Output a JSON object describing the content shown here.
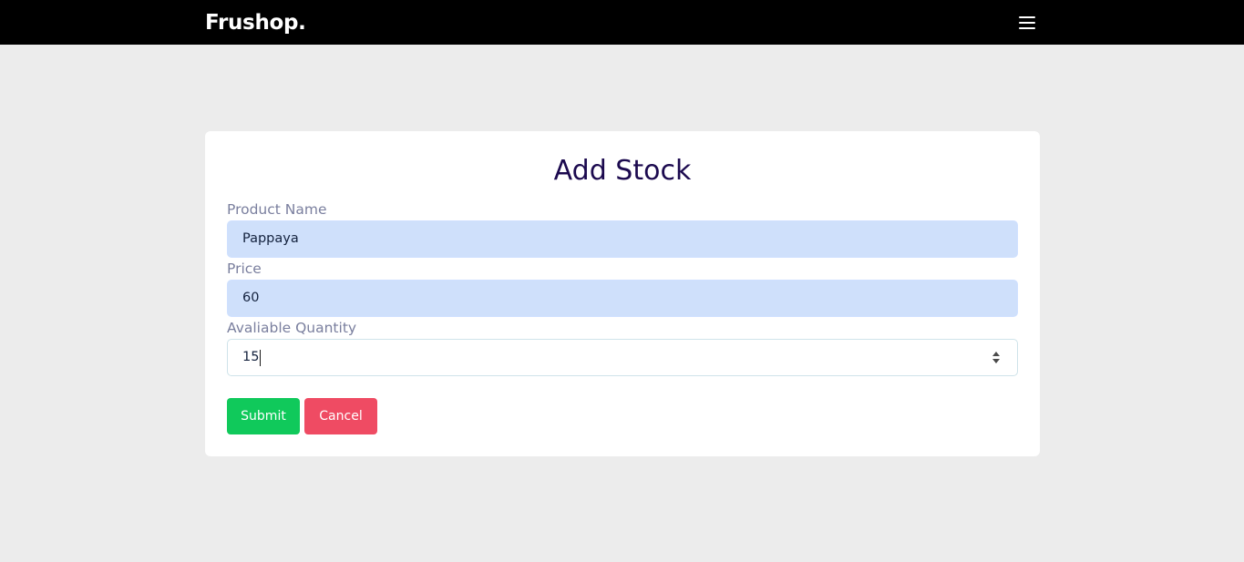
{
  "navbar": {
    "brand": "Frushop.",
    "menu_icon": "hamburger-menu-icon"
  },
  "form": {
    "title": "Add Stock",
    "fields": [
      {
        "label": "Product Name",
        "value": "Pappaya"
      },
      {
        "label": "Price",
        "value": "60"
      },
      {
        "label": "Avaliable Quantity",
        "value": "15"
      }
    ],
    "submit_label": "Submit",
    "cancel_label": "Cancel"
  },
  "colors": {
    "navbar_bg": "#000000",
    "page_bg": "#ececec",
    "title": "#1c0a4f",
    "autofill_bg": "#cfe0fb",
    "submit": "#10c95b",
    "cancel": "#ef4b63"
  }
}
